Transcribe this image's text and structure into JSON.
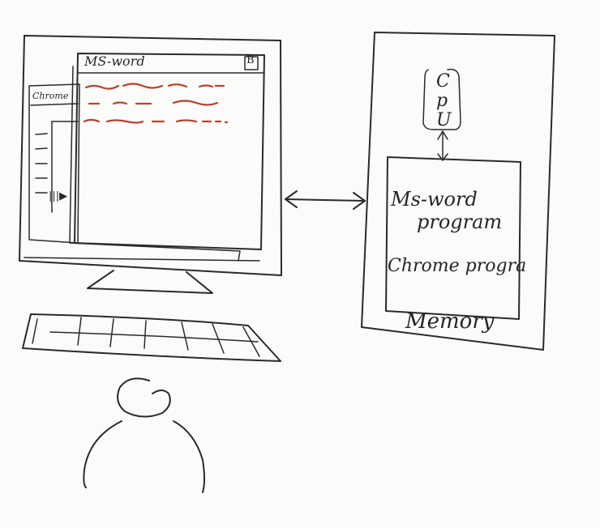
{
  "monitor": {
    "msword_window": {
      "title": "MS-word",
      "maximize_glyph": "B"
    },
    "chrome_window": {
      "title": "Chrome",
      "play_glyph": "|||▶"
    },
    "text_line_colors": [
      "#b8412f",
      "#2a2a2a"
    ]
  },
  "memory_box": {
    "cpu_letters": [
      "C",
      "p",
      "U"
    ],
    "program_1_line_1": "Ms-word",
    "program_1_line_2": "program",
    "program_2": "Chrome progra",
    "label": "Memory"
  },
  "icons": [
    "monitor-icon",
    "keyboard-icon",
    "person-icon",
    "double-arrow-icon"
  ],
  "colors": {
    "ink": "#2a2a2a",
    "accent_ink": "#b8412f",
    "board": "#fbfbf9"
  }
}
